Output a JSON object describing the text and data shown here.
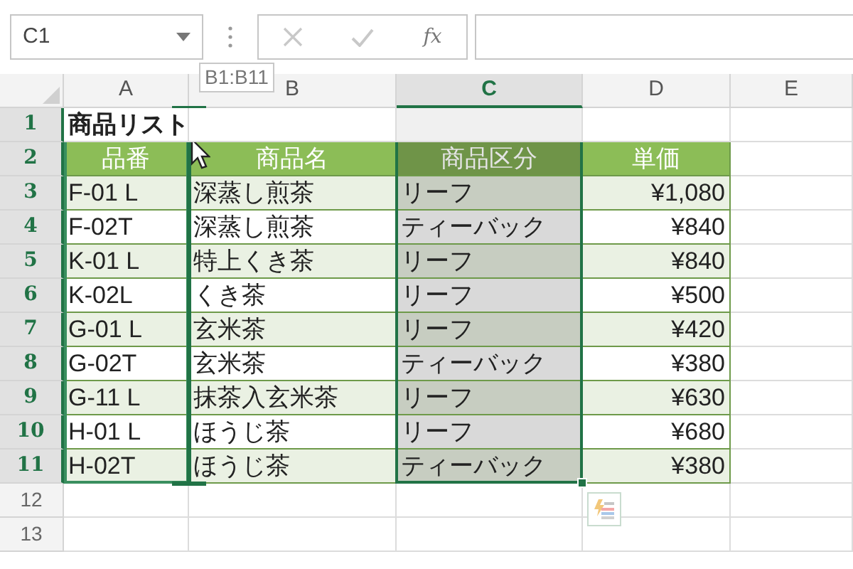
{
  "name_box": {
    "value": "C1"
  },
  "formula_bar": {
    "function_label": "fx"
  },
  "tooltip": "B1:B11",
  "columns": [
    {
      "label": "A",
      "selected": false
    },
    {
      "label": "B",
      "selected": false
    },
    {
      "label": "C",
      "selected": true
    },
    {
      "label": "D",
      "selected": false
    },
    {
      "label": "E",
      "selected": false
    }
  ],
  "rows": [
    {
      "number": "1",
      "selected": true,
      "kind": "title",
      "cells": [
        "商品リスト",
        "",
        "",
        "",
        ""
      ]
    },
    {
      "number": "2",
      "selected": true,
      "kind": "header",
      "cells": [
        "品番",
        "商品名",
        "商品区分",
        "単価",
        ""
      ]
    },
    {
      "number": "3",
      "selected": true,
      "kind": "data",
      "banded": true,
      "cells": [
        "F-01 L",
        "深蒸し煎茶",
        "リーフ",
        "¥1,080",
        ""
      ]
    },
    {
      "number": "4",
      "selected": true,
      "kind": "data",
      "banded": false,
      "cells": [
        "F-02T",
        "深蒸し煎茶",
        "ティーバック",
        "¥840",
        ""
      ]
    },
    {
      "number": "5",
      "selected": true,
      "kind": "data",
      "banded": true,
      "cells": [
        "K-01 L",
        "特上くき茶",
        "リーフ",
        "¥840",
        ""
      ]
    },
    {
      "number": "6",
      "selected": true,
      "kind": "data",
      "banded": false,
      "cells": [
        "K-02L",
        "くき茶",
        "リーフ",
        "¥500",
        ""
      ]
    },
    {
      "number": "7",
      "selected": true,
      "kind": "data",
      "banded": true,
      "cells": [
        "G-01 L",
        "玄米茶",
        "リーフ",
        "¥420",
        ""
      ]
    },
    {
      "number": "8",
      "selected": true,
      "kind": "data",
      "banded": false,
      "cells": [
        "G-02T",
        "玄米茶",
        "ティーバック",
        "¥380",
        ""
      ]
    },
    {
      "number": "9",
      "selected": true,
      "kind": "data",
      "banded": true,
      "cells": [
        "G-11 L",
        "抹茶入玄米茶",
        "リーフ",
        "¥630",
        ""
      ]
    },
    {
      "number": "10",
      "selected": true,
      "kind": "data",
      "banded": false,
      "cells": [
        "H-01 L",
        "ほうじ茶",
        "リーフ",
        "¥680",
        ""
      ]
    },
    {
      "number": "11",
      "selected": true,
      "kind": "data",
      "banded": true,
      "cells": [
        "H-02T",
        "ほうじ茶",
        "ティーバック",
        "¥380",
        ""
      ]
    },
    {
      "number": "12",
      "selected": false,
      "kind": "empty",
      "cells": [
        "",
        "",
        "",
        "",
        ""
      ]
    },
    {
      "number": "13",
      "selected": false,
      "kind": "empty",
      "cells": [
        "",
        "",
        "",
        "",
        ""
      ]
    }
  ]
}
